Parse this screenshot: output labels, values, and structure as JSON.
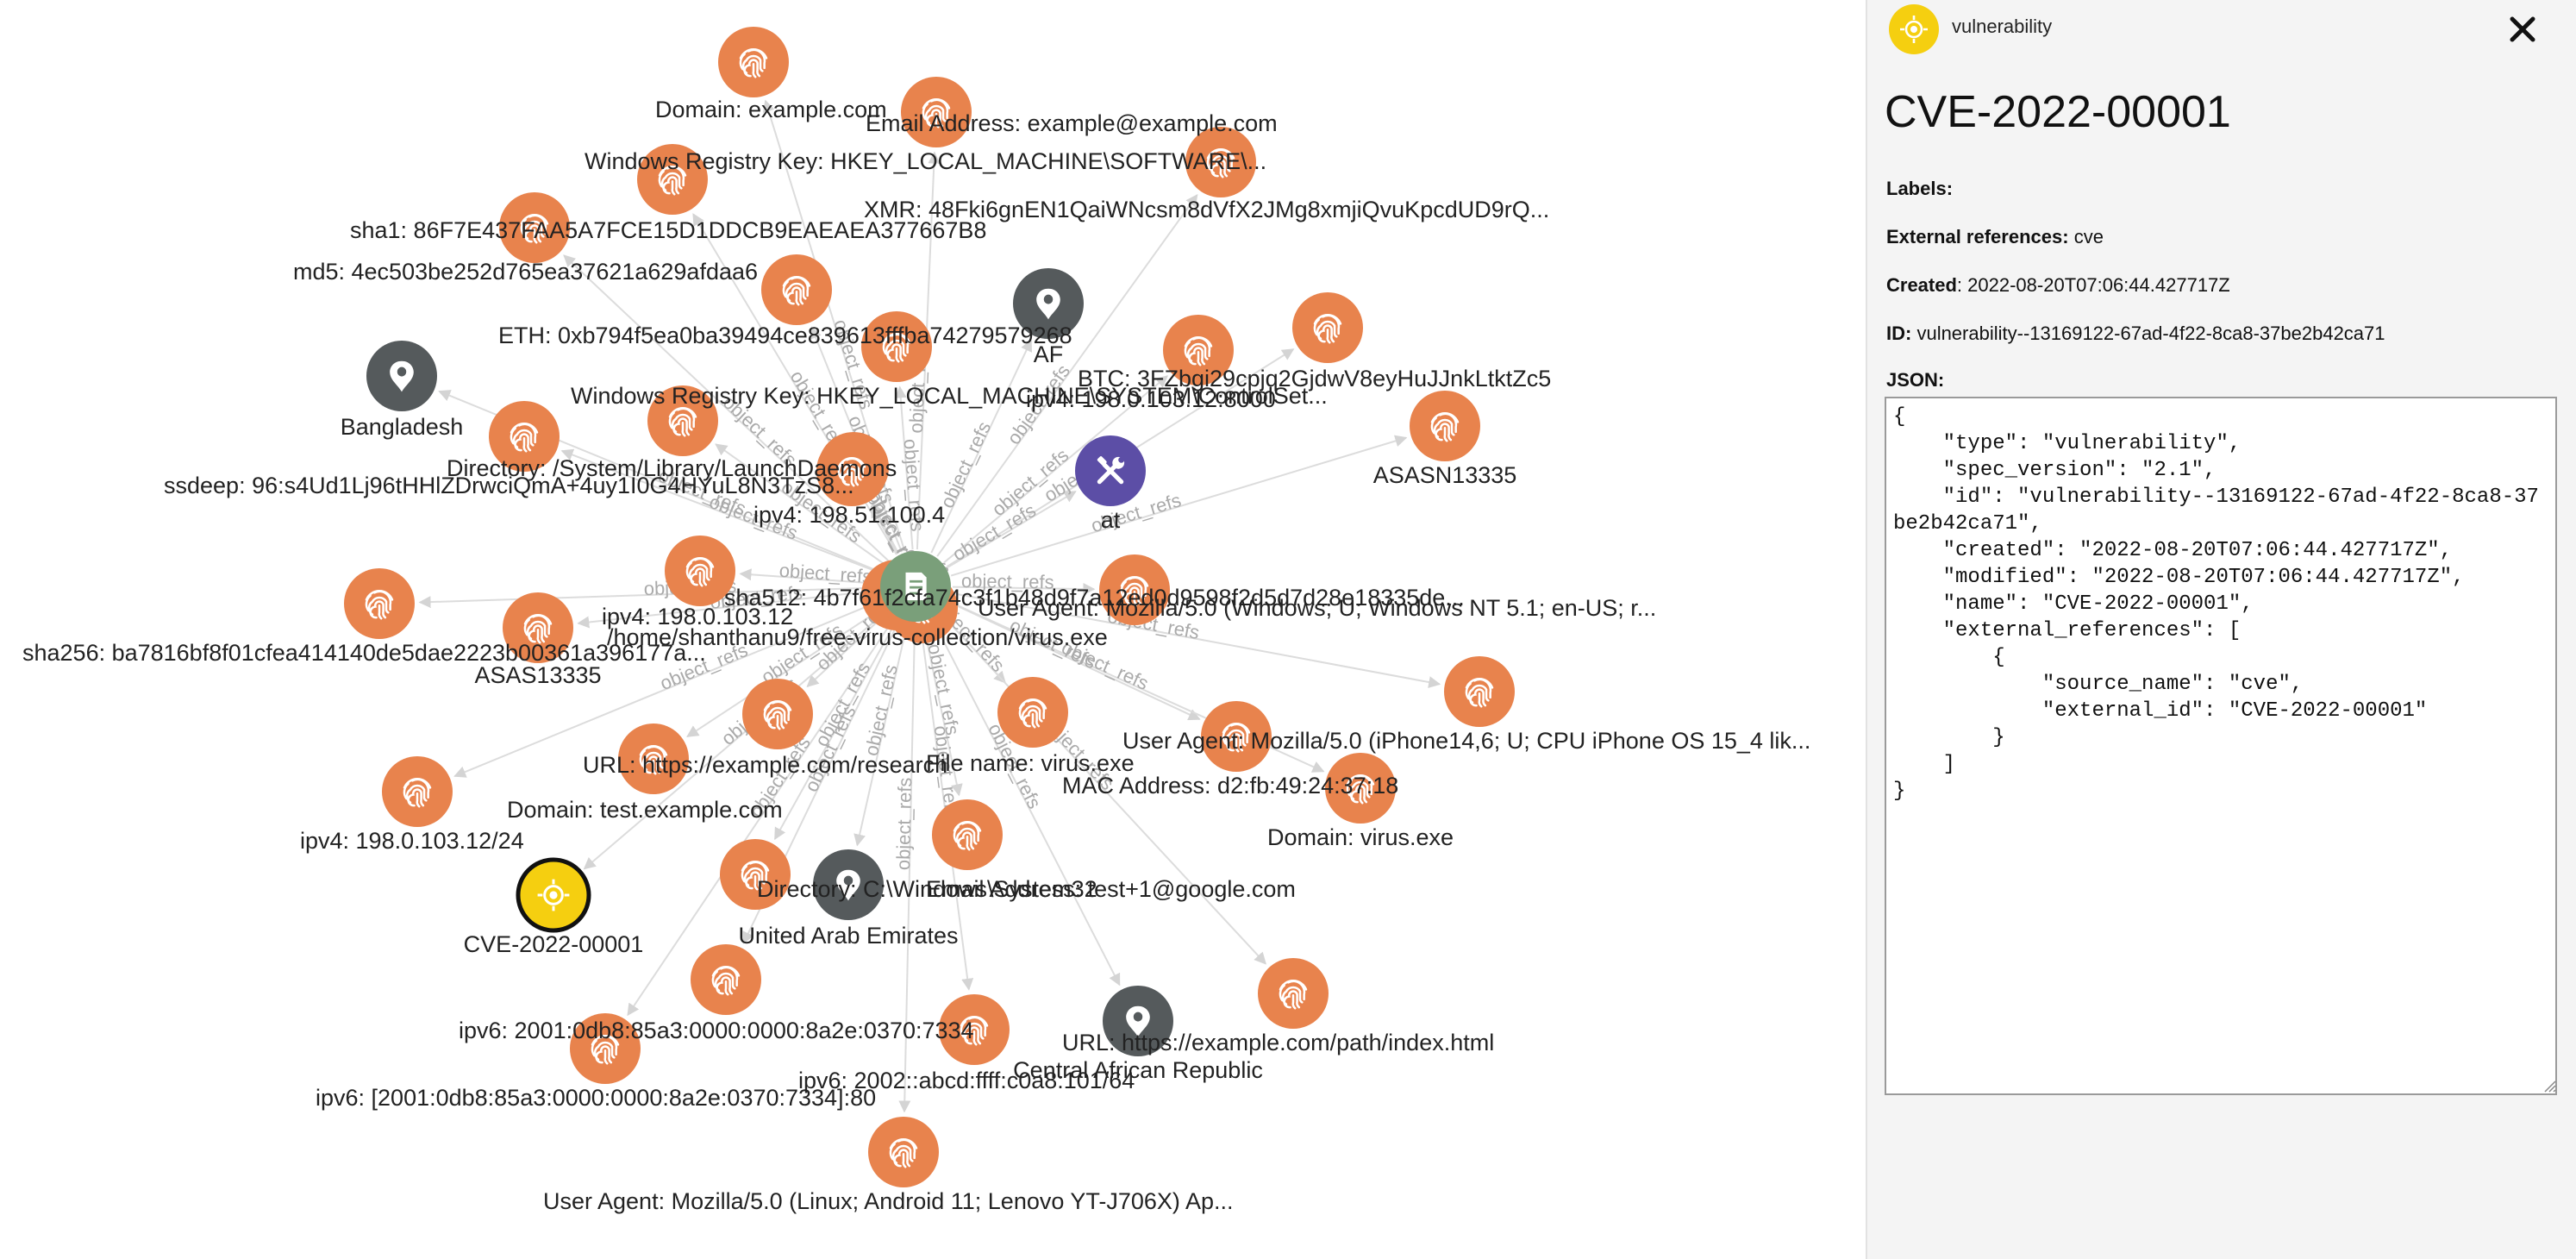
{
  "colors": {
    "observable_node": "#e8834d",
    "location_node": "#555a5c",
    "tool_node": "#5c4ea6",
    "report_node": "#7a9f7a",
    "vulnerability_node": "#f5cf10",
    "edge": "#dcdcdc",
    "edge_label": "#aaaaaa"
  },
  "graph": {
    "center": {
      "icon": "document-icon",
      "kind": "report"
    },
    "edge_label": "object_refs",
    "nodes": [
      {
        "label": "Domain: example.com",
        "kind": "observable",
        "icon": "fingerprint-icon"
      },
      {
        "label": "Email Address: example@example.com",
        "kind": "observable",
        "icon": "fingerprint-icon"
      },
      {
        "label": "Windows Registry Key: HKEY_LOCAL_MACHINE\\SOFTWARE\\...",
        "kind": "observable",
        "icon": "fingerprint-icon"
      },
      {
        "label": "XMR: 48Fki6gnEN1QaiWNcsm8dVfX2JMg8xmjiQvuKpcdUD9rQ...",
        "kind": "observable",
        "icon": "fingerprint-icon"
      },
      {
        "label": "sha1: 86F7E437FAA5A7FCE15D1DDCB9EAEAEA377667B8",
        "kind": "observable",
        "icon": "fingerprint-icon"
      },
      {
        "label": "md5: 4ec503be252d765ea37621a629afdaa6",
        "kind": "observable",
        "icon": "fingerprint-icon"
      },
      {
        "label": "ETH: 0xb794f5ea0ba39494ce839613fffba74279579268",
        "kind": "observable",
        "icon": "fingerprint-icon"
      },
      {
        "label": "AF",
        "kind": "location",
        "icon": "map-pin-icon"
      },
      {
        "label": "BTC: 3FZbgi29cpjq2GjdwV8eyHuJJnkLtktZc5",
        "kind": "observable",
        "icon": "fingerprint-icon"
      },
      {
        "label": "ipv4: 198.0.103.12:8000",
        "kind": "observable",
        "icon": "fingerprint-icon"
      },
      {
        "label": "Bangladesh",
        "kind": "location",
        "icon": "map-pin-icon"
      },
      {
        "label": "Windows Registry Key: HKEY_LOCAL_MACHINE\\SYSTEM\\ControlSet...",
        "kind": "observable",
        "icon": "fingerprint-icon"
      },
      {
        "label": "Directory: /System/Library/LaunchDaemons",
        "kind": "observable",
        "icon": "fingerprint-icon"
      },
      {
        "label": "ssdeep: 96:s4Ud1Lj96tHHlZDrwciQmA+4uy1I0G4HYuL8N3TzS8...",
        "kind": "observable",
        "icon": "fingerprint-icon"
      },
      {
        "label": "ipv4: 198.51.100.4",
        "kind": "observable",
        "icon": "fingerprint-icon"
      },
      {
        "label": "at",
        "kind": "tool",
        "icon": "tools-icon"
      },
      {
        "label": "ASASN13335",
        "kind": "observable",
        "icon": "fingerprint-icon"
      },
      {
        "label": "ipv4: 198.0.103.12",
        "kind": "observable",
        "icon": "fingerprint-icon"
      },
      {
        "label": "sha256: ba7816bf8f01cfea414140de5dae2223b00361a396177a...",
        "kind": "observable",
        "icon": "fingerprint-icon"
      },
      {
        "label": "ASAS13335",
        "kind": "observable",
        "icon": "fingerprint-icon"
      },
      {
        "label": "/home/shanthanu9/free-virus-collection/virus.exe",
        "kind": "observable",
        "icon": "fingerprint-icon"
      },
      {
        "label": "sha512: 4b7f61f2cfa74c3f1b48d9f7a12ed0d9598f2d5d7d28e18335de...",
        "kind": "observable",
        "icon": "fingerprint-icon"
      },
      {
        "label": "User Agent: Mozilla/5.0 (Windows; U; Windows NT 5.1; en-US; r...",
        "kind": "observable",
        "icon": "fingerprint-icon"
      },
      {
        "label": "User Agent: Mozilla/5.0 (iPhone14,6; U; CPU iPhone OS 15_4 lik...",
        "kind": "observable",
        "icon": "fingerprint-icon"
      },
      {
        "label": "URL: https://example.com/research",
        "kind": "observable",
        "icon": "fingerprint-icon"
      },
      {
        "label": "File name: virus.exe",
        "kind": "observable",
        "icon": "fingerprint-icon"
      },
      {
        "label": "MAC Address: d2:fb:49:24:37:18",
        "kind": "observable",
        "icon": "fingerprint-icon"
      },
      {
        "label": "Domain: test.example.com",
        "kind": "observable",
        "icon": "fingerprint-icon"
      },
      {
        "label": "Domain: virus.exe",
        "kind": "observable",
        "icon": "fingerprint-icon"
      },
      {
        "label": "ipv4: 198.0.103.12/24",
        "kind": "observable",
        "icon": "fingerprint-icon"
      },
      {
        "label": "CVE-2022-00001",
        "kind": "vulnerability",
        "icon": "target-icon",
        "selected": true
      },
      {
        "label": "Directory: C:\\Windows\\System32",
        "kind": "observable",
        "icon": "fingerprint-icon"
      },
      {
        "label": "Email Address: test+1@google.com",
        "kind": "observable",
        "icon": "fingerprint-icon"
      },
      {
        "label": "United Arab Emirates",
        "kind": "location",
        "icon": "map-pin-icon"
      },
      {
        "label": "ipv6: 2001:0db8:85a3:0000:0000:8a2e:0370:7334",
        "kind": "observable",
        "icon": "fingerprint-icon"
      },
      {
        "label": "ipv6: [2001:0db8:85a3:0000:0000:8a2e:0370:7334]:80",
        "kind": "observable",
        "icon": "fingerprint-icon"
      },
      {
        "label": "ipv6: 2002::abcd:ffff:c0a8:101/64",
        "kind": "observable",
        "icon": "fingerprint-icon"
      },
      {
        "label": "URL: https://example.com/path/index.html",
        "kind": "observable",
        "icon": "fingerprint-icon"
      },
      {
        "label": "Central African Republic",
        "kind": "location",
        "icon": "map-pin-icon"
      },
      {
        "label": "User Agent: Mozilla/5.0 (Linux; Android 11; Lenovo YT-J706X) Ap...",
        "kind": "observable",
        "icon": "fingerprint-icon"
      }
    ]
  },
  "panel": {
    "type_icon": "target-icon",
    "type_label": "vulnerability",
    "close_icon": "close-icon",
    "title": "CVE-2022-00001",
    "labels_label": "Labels:",
    "labels_value": "",
    "ext_refs_label": "External references:",
    "ext_refs_value": "cve",
    "created_label": "Created",
    "created_value": "2022-08-20T07:06:44.427717Z",
    "id_label": "ID:",
    "id_value": "vulnerability--13169122-67ad-4f22-8ca8-37be2b42ca71",
    "json_label": "JSON:",
    "json_text": "{\n    \"type\": \"vulnerability\",\n    \"spec_version\": \"2.1\",\n    \"id\": \"vulnerability--13169122-67ad-4f22-8ca8-37be2b42ca71\",\n    \"created\": \"2022-08-20T07:06:44.427717Z\",\n    \"modified\": \"2022-08-20T07:06:44.427717Z\",\n    \"name\": \"CVE-2022-00001\",\n    \"external_references\": [\n        {\n            \"source_name\": \"cve\",\n            \"external_id\": \"CVE-2022-00001\"\n        }\n    ]\n}"
  }
}
